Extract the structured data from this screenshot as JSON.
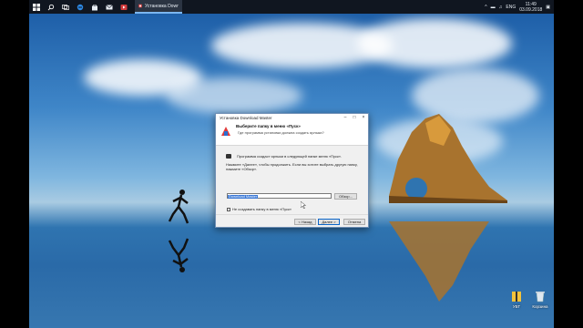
{
  "taskbar": {
    "app_title": "Установка Download Master",
    "language": "ENG",
    "time": "11:49",
    "date": "03.09.2018",
    "icons": [
      "windows-start-icon",
      "search-icon",
      "task-view-icon",
      "edge-icon",
      "store-icon",
      "mail-icon",
      "media-icon"
    ]
  },
  "desktop": {
    "icons": [
      {
        "label": "УБТ",
        "icon": "archive-icon"
      },
      {
        "label": "Корзина",
        "icon": "recycle-bin-icon"
      }
    ]
  },
  "dialog": {
    "title": "Установка Download Master",
    "header_title": "Выберите папку в меню «Пуск»",
    "header_subtitle": "Где программа установки должна создать ярлыки?",
    "text1": "Программа создаст ярлыки в следующей папке меню «Пуск».",
    "text2": "Нажмите «Далее», чтобы продолжить. Если вы хотите выбрать другую папку, нажмите «Обзор».",
    "folder_value": "Download Master",
    "browse_label": "Обзор...",
    "checkbox_label": "Не создавать папку в меню «Пуск»",
    "back_label": "< Назад",
    "next_label": "Далее >",
    "cancel_label": "Отмена"
  }
}
